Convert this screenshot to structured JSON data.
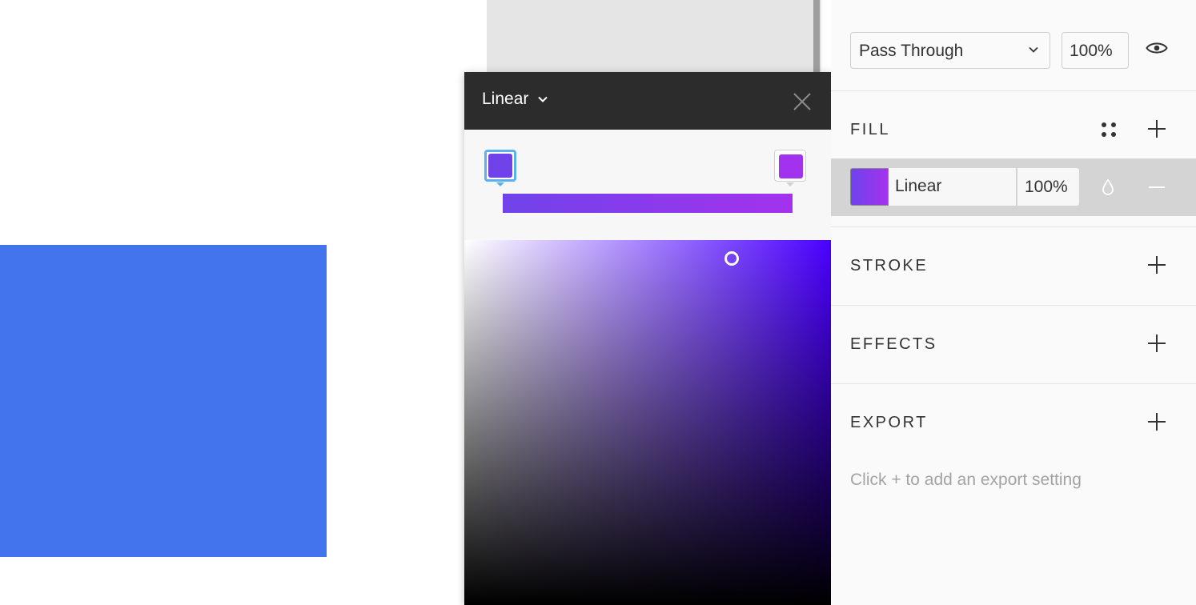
{
  "picker": {
    "mode_label": "Linear",
    "mode_chevron_icon": "chevron-down-icon",
    "close_icon": "close-icon",
    "stops": [
      {
        "color": "#7043EA",
        "selected": true,
        "position": 0
      },
      {
        "color": "#A332EE",
        "selected": false,
        "position": 1
      }
    ],
    "field_hue_color": "#4A00FF",
    "handle_saturation": 0.73,
    "handle_brightness": 0.95
  },
  "layer": {
    "blend_mode": "Pass Through",
    "opacity": "100%",
    "visibility_icon": "eye-icon"
  },
  "fill": {
    "title": "FILL",
    "styles_icon": "four-dots-icon",
    "add_icon": "plus-icon",
    "items": [
      {
        "type": "Linear",
        "opacity": "100%",
        "color_start": "#7043EA",
        "color_end": "#A332EE",
        "blend_icon": "drop-icon",
        "remove_icon": "minus-icon"
      }
    ]
  },
  "stroke": {
    "title": "STROKE"
  },
  "effects": {
    "title": "EFFECTS"
  },
  "export": {
    "title": "EXPORT",
    "hint": "Click + to add an export setting"
  },
  "canvas": {
    "rect_color": "#4374ED"
  }
}
